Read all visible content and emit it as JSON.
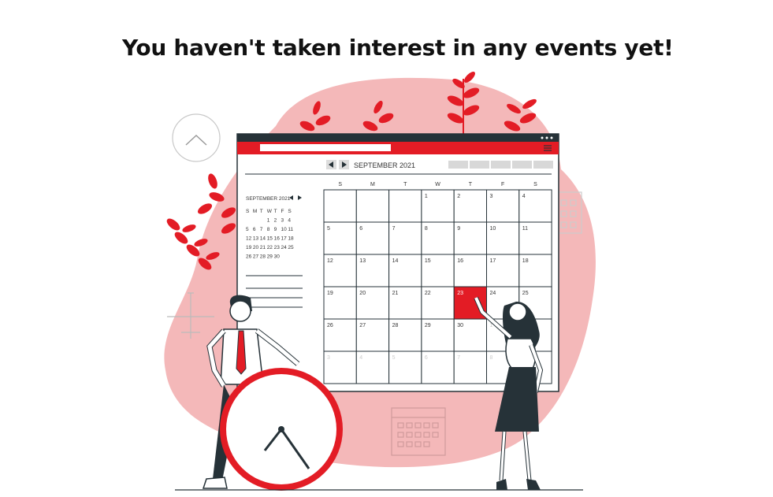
{
  "empty_state": {
    "title": "You haven't taken interest in any events yet!"
  },
  "calendar": {
    "month_label": "SEPTEMBER 2021",
    "weekdays": [
      "S",
      "M",
      "T",
      "W",
      "T",
      "F",
      "S"
    ],
    "highlight_day": "23",
    "accent": "#e31c25"
  },
  "mini_calendar": {
    "month_label": "SEPTEMBER 2021",
    "weekdays": [
      "S",
      "M",
      "T",
      "W",
      "T",
      "F",
      "S"
    ],
    "rows": [
      [
        "",
        "",
        "",
        "1",
        "2",
        "3",
        "4"
      ],
      [
        "5",
        "6",
        "7",
        "8",
        "9",
        "10",
        "11"
      ],
      [
        "12",
        "13",
        "14",
        "15",
        "16",
        "17",
        "18"
      ],
      [
        "19",
        "20",
        "21",
        "22",
        "23",
        "24",
        "25"
      ],
      [
        "26",
        "27",
        "28",
        "29",
        "30",
        "",
        ""
      ]
    ]
  },
  "icons": {
    "scroll_up": "chevron-up-icon"
  },
  "colors": {
    "blob": "#f4b8b9",
    "accent": "#e31c25",
    "dark": "#263238"
  }
}
